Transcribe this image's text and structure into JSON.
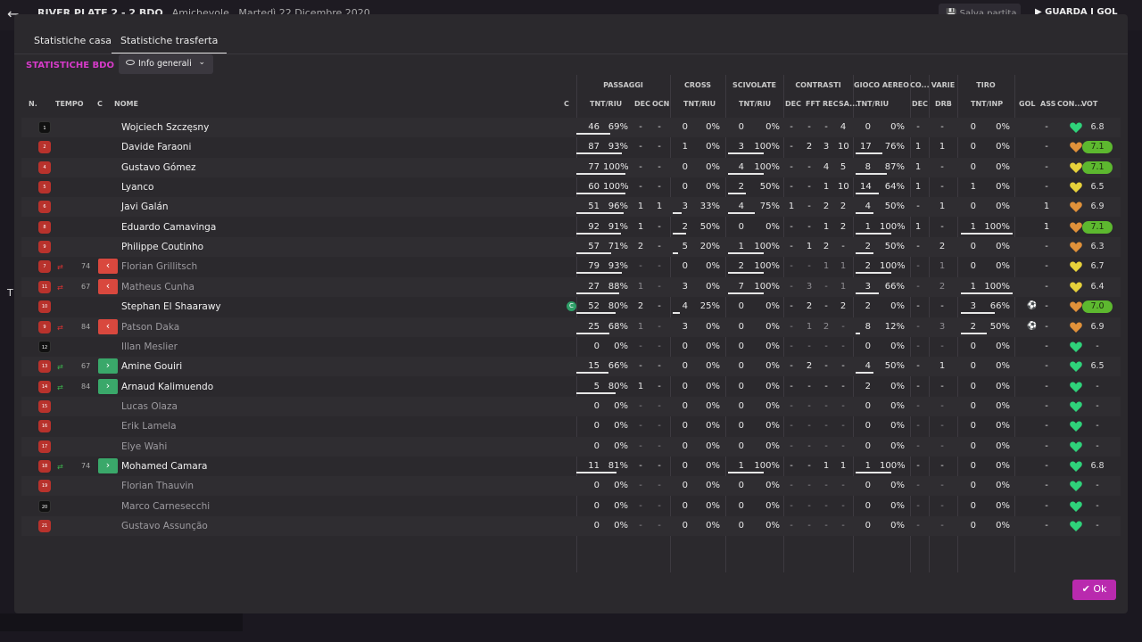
{
  "background": {
    "match_title": "RIVER PLATE 2 - 2 BDO",
    "match_type": "Amichevole",
    "match_date": "Martedì 22 Dicembre 2020",
    "save_label": "Salva partita",
    "watch_label": "GUARDA I GOL"
  },
  "tabs": [
    "Statistiche casa",
    "Statistiche trasferta"
  ],
  "active_tab": 1,
  "stats_label": "STATISTICHE BDO",
  "view_select": "Info generali",
  "groups": {
    "passaggi": "PASSAGGI",
    "cross": "CROSS",
    "scivolate": "SCIVOLATE",
    "contrasti": "CONTRASTI",
    "gioco_aereo": "GIOCO AEREO",
    "co": "CO...",
    "varie": "VARIE",
    "tiro": "TIRO"
  },
  "headers": {
    "n": "N.",
    "tempo": "TEMPO",
    "c": "C",
    "nome": "NOME",
    "cap": "C",
    "pass": "TNT/RIU",
    "dec": "DEC",
    "ocn": "OCN",
    "cross": "TNT/RIU",
    "sciv": "TNT/RIU",
    "ct_dec": "DEC",
    "ct_fft": "FFT",
    "ct_rec": "REC",
    "ct_sa": "SA...",
    "aereo": "TNT/RIU",
    "co_dec": "DEC",
    "drb": "DRB",
    "tiro": "TNT/INP",
    "gol": "GOL",
    "ass": "ASS",
    "con": "CON...",
    "vot": "VOT"
  },
  "colors": {
    "accent": "#d63bc9",
    "sub_out": "#d9483e",
    "sub_in": "#3aa86a",
    "heart_green": "#2fd27a",
    "heart_orange": "#e0913a",
    "heart_yellow": "#e6d13b",
    "rating_high": "#5db82f"
  },
  "players": [
    {
      "num": "1",
      "gk": true,
      "name": "Wojciech Szczęsny",
      "p": "46",
      "pp": "69%",
      "pd": "-",
      "po": "-",
      "cr": "0",
      "crp": "0%",
      "sc": "0",
      "scp": "0%",
      "cd": "-",
      "cf": "-",
      "cre": "-",
      "cs": "4",
      "ae": "0",
      "aep": "0%",
      "cod": "-",
      "drb": "-",
      "ti": "0",
      "tip": "0%",
      "gol": "",
      "ass": "-",
      "con": "green",
      "vot": "6.8",
      "hi": false,
      "bars": {
        "p": 0.69
      }
    },
    {
      "num": "2",
      "name": "Davide Faraoni",
      "p": "87",
      "pp": "93%",
      "pd": "-",
      "po": "-",
      "cr": "1",
      "crp": "0%",
      "sc": "3",
      "scp": "100%",
      "cd": "-",
      "cf": "2",
      "cre": "3",
      "cs": "10",
      "ae": "17",
      "aep": "76%",
      "cod": "1",
      "drb": "1",
      "ti": "0",
      "tip": "0%",
      "gol": "",
      "ass": "-",
      "con": "orange",
      "vot": "7.1",
      "hi": true,
      "bars": {
        "p": 0.93,
        "sc": 1.0,
        "ae": 0.76
      }
    },
    {
      "num": "4",
      "name": "Gustavo Gómez",
      "p": "77",
      "pp": "100%",
      "pd": "-",
      "po": "-",
      "cr": "0",
      "crp": "0%",
      "sc": "4",
      "scp": "100%",
      "cd": "-",
      "cf": "-",
      "cre": "4",
      "cs": "5",
      "ae": "8",
      "aep": "87%",
      "cod": "1",
      "drb": "-",
      "ti": "0",
      "tip": "0%",
      "gol": "",
      "ass": "-",
      "con": "yellow",
      "vot": "7.1",
      "hi": true,
      "bars": {
        "p": 1.0,
        "sc": 1.0,
        "ae": 0.87
      }
    },
    {
      "num": "5",
      "name": "Lyanco",
      "p": "60",
      "pp": "100%",
      "pd": "-",
      "po": "-",
      "cr": "0",
      "crp": "0%",
      "sc": "2",
      "scp": "50%",
      "cd": "-",
      "cf": "-",
      "cre": "1",
      "cs": "10",
      "ae": "14",
      "aep": "64%",
      "cod": "1",
      "drb": "-",
      "ti": "1",
      "tip": "0%",
      "gol": "",
      "ass": "-",
      "con": "yellow",
      "vot": "6.5",
      "hi": false,
      "bars": {
        "p": 1.0,
        "sc": 0.5,
        "ae": 0.64
      }
    },
    {
      "num": "6",
      "name": "Javi Galán",
      "p": "51",
      "pp": "96%",
      "pd": "1",
      "po": "1",
      "cr": "3",
      "crp": "33%",
      "sc": "4",
      "scp": "75%",
      "cd": "1",
      "cf": "-",
      "cre": "2",
      "cs": "2",
      "ae": "4",
      "aep": "50%",
      "cod": "-",
      "drb": "1",
      "ti": "0",
      "tip": "0%",
      "gol": "",
      "ass": "1",
      "con": "orange",
      "vot": "6.9",
      "hi": false,
      "bars": {
        "p": 0.96,
        "cr": 0.33,
        "sc": 0.75,
        "ae": 0.5
      }
    },
    {
      "num": "8",
      "name": "Eduardo Camavinga",
      "p": "92",
      "pp": "91%",
      "pd": "1",
      "po": "-",
      "cr": "2",
      "crp": "50%",
      "sc": "0",
      "scp": "0%",
      "cd": "-",
      "cf": "-",
      "cre": "1",
      "cs": "2",
      "ae": "1",
      "aep": "100%",
      "cod": "1",
      "drb": "-",
      "ti": "1",
      "tip": "100%",
      "gol": "",
      "ass": "1",
      "con": "orange",
      "vot": "7.1",
      "hi": true,
      "bars": {
        "p": 0.91,
        "cr": 0.5,
        "ae": 1.0,
        "ti": 1.0
      }
    },
    {
      "num": "9",
      "name": "Philippe Coutinho",
      "p": "57",
      "pp": "71%",
      "pd": "2",
      "po": "-",
      "cr": "5",
      "crp": "20%",
      "sc": "1",
      "scp": "100%",
      "cd": "-",
      "cf": "1",
      "cre": "2",
      "cs": "-",
      "ae": "2",
      "aep": "50%",
      "cod": "-",
      "drb": "2",
      "ti": "0",
      "tip": "0%",
      "gol": "",
      "ass": "-",
      "con": "orange",
      "vot": "6.3",
      "hi": false,
      "bars": {
        "p": 0.71,
        "cr": 0.2,
        "sc": 1.0,
        "ae": 0.5
      }
    },
    {
      "num": "7",
      "sub": "out",
      "min": "74",
      "dim": true,
      "name": "Florian Grillitsch",
      "p": "79",
      "pp": "93%",
      "pd": "-",
      "po": "-",
      "cr": "0",
      "crp": "0%",
      "sc": "2",
      "scp": "100%",
      "cd": "-",
      "cf": "-",
      "cre": "1",
      "cs": "1",
      "ae": "2",
      "aep": "100%",
      "cod": "-",
      "drb": "1",
      "ti": "0",
      "tip": "0%",
      "gol": "",
      "ass": "-",
      "con": "yellow",
      "vot": "6.7",
      "hi": false,
      "bars": {
        "p": 0.93,
        "sc": 1.0,
        "ae": 1.0
      }
    },
    {
      "num": "11",
      "sub": "out",
      "min": "67",
      "dim": true,
      "name": "Matheus Cunha",
      "p": "27",
      "pp": "88%",
      "pd": "1",
      "po": "-",
      "cr": "3",
      "crp": "0%",
      "sc": "7",
      "scp": "100%",
      "cd": "-",
      "cf": "3",
      "cre": "-",
      "cs": "1",
      "ae": "3",
      "aep": "66%",
      "cod": "-",
      "drb": "2",
      "ti": "1",
      "tip": "100%",
      "gol": "",
      "ass": "-",
      "con": "yellow",
      "vot": "6.4",
      "hi": false,
      "bars": {
        "p": 0.88,
        "sc": 1.0,
        "ae": 0.66,
        "ti": 1.0
      }
    },
    {
      "num": "10",
      "cap": true,
      "name": "Stephan El Shaarawy",
      "p": "52",
      "pp": "80%",
      "pd": "2",
      "po": "-",
      "cr": "4",
      "crp": "25%",
      "sc": "0",
      "scp": "0%",
      "cd": "-",
      "cf": "2",
      "cre": "-",
      "cs": "2",
      "ae": "2",
      "aep": "0%",
      "cod": "-",
      "drb": "-",
      "ti": "3",
      "tip": "66%",
      "gol": "⚽",
      "ass": "-",
      "con": "orange",
      "vot": "7.0",
      "hi": true,
      "bars": {
        "p": 0.8,
        "cr": 0.25,
        "ti": 0.66
      }
    },
    {
      "num": "9",
      "sub": "out",
      "min": "84",
      "dim": true,
      "name": "Patson Daka",
      "p": "25",
      "pp": "68%",
      "pd": "1",
      "po": "-",
      "cr": "3",
      "crp": "0%",
      "sc": "0",
      "scp": "0%",
      "cd": "-",
      "cf": "1",
      "cre": "2",
      "cs": "-",
      "ae": "8",
      "aep": "12%",
      "cod": "-",
      "drb": "3",
      "ti": "2",
      "tip": "50%",
      "gol": "⚽",
      "ass": "-",
      "con": "orange",
      "vot": "6.9",
      "hi": false,
      "bars": {
        "p": 0.68,
        "ae": 0.12,
        "ti": 0.5
      }
    },
    {
      "num": "12",
      "gk": true,
      "dim": true,
      "name": "Illan Meslier",
      "p": "0",
      "pp": "0%",
      "pd": "-",
      "po": "-",
      "cr": "0",
      "crp": "0%",
      "sc": "0",
      "scp": "0%",
      "cd": "-",
      "cf": "-",
      "cre": "-",
      "cs": "-",
      "ae": "0",
      "aep": "0%",
      "cod": "-",
      "drb": "-",
      "ti": "0",
      "tip": "0%",
      "gol": "",
      "ass": "-",
      "con": "green",
      "vot": "-",
      "hi": false,
      "bars": {}
    },
    {
      "num": "13",
      "sub": "in",
      "min": "67",
      "name": "Amine Gouiri",
      "p": "15",
      "pp": "66%",
      "pd": "-",
      "po": "-",
      "cr": "0",
      "crp": "0%",
      "sc": "0",
      "scp": "0%",
      "cd": "-",
      "cf": "2",
      "cre": "-",
      "cs": "-",
      "ae": "4",
      "aep": "50%",
      "cod": "-",
      "drb": "1",
      "ti": "0",
      "tip": "0%",
      "gol": "",
      "ass": "-",
      "con": "green",
      "vot": "6.5",
      "hi": false,
      "bars": {
        "p": 0.66,
        "ae": 0.5
      }
    },
    {
      "num": "14",
      "sub": "in",
      "min": "84",
      "name": "Arnaud Kalimuendo",
      "p": "5",
      "pp": "80%",
      "pd": "1",
      "po": "-",
      "cr": "0",
      "crp": "0%",
      "sc": "0",
      "scp": "0%",
      "cd": "-",
      "cf": "-",
      "cre": "-",
      "cs": "-",
      "ae": "2",
      "aep": "0%",
      "cod": "-",
      "drb": "-",
      "ti": "0",
      "tip": "0%",
      "gol": "",
      "ass": "-",
      "con": "green",
      "vot": "-",
      "hi": false,
      "bars": {
        "p": 0.8
      }
    },
    {
      "num": "15",
      "dim": true,
      "name": "Lucas Olaza",
      "p": "0",
      "pp": "0%",
      "pd": "-",
      "po": "-",
      "cr": "0",
      "crp": "0%",
      "sc": "0",
      "scp": "0%",
      "cd": "-",
      "cf": "-",
      "cre": "-",
      "cs": "-",
      "ae": "0",
      "aep": "0%",
      "cod": "-",
      "drb": "-",
      "ti": "0",
      "tip": "0%",
      "gol": "",
      "ass": "-",
      "con": "green",
      "vot": "-",
      "hi": false,
      "bars": {}
    },
    {
      "num": "16",
      "dim": true,
      "name": "Erik Lamela",
      "p": "0",
      "pp": "0%",
      "pd": "-",
      "po": "-",
      "cr": "0",
      "crp": "0%",
      "sc": "0",
      "scp": "0%",
      "cd": "-",
      "cf": "-",
      "cre": "-",
      "cs": "-",
      "ae": "0",
      "aep": "0%",
      "cod": "-",
      "drb": "-",
      "ti": "0",
      "tip": "0%",
      "gol": "",
      "ass": "-",
      "con": "green",
      "vot": "-",
      "hi": false,
      "bars": {}
    },
    {
      "num": "17",
      "dim": true,
      "name": "Elye Wahi",
      "p": "0",
      "pp": "0%",
      "pd": "-",
      "po": "-",
      "cr": "0",
      "crp": "0%",
      "sc": "0",
      "scp": "0%",
      "cd": "-",
      "cf": "-",
      "cre": "-",
      "cs": "-",
      "ae": "0",
      "aep": "0%",
      "cod": "-",
      "drb": "-",
      "ti": "0",
      "tip": "0%",
      "gol": "",
      "ass": "-",
      "con": "green",
      "vot": "-",
      "hi": false,
      "bars": {}
    },
    {
      "num": "18",
      "sub": "in",
      "min": "74",
      "name": "Mohamed Camara",
      "p": "11",
      "pp": "81%",
      "pd": "-",
      "po": "-",
      "cr": "0",
      "crp": "0%",
      "sc": "1",
      "scp": "100%",
      "cd": "-",
      "cf": "-",
      "cre": "1",
      "cs": "1",
      "ae": "1",
      "aep": "100%",
      "cod": "-",
      "drb": "-",
      "ti": "0",
      "tip": "0%",
      "gol": "",
      "ass": "-",
      "con": "green",
      "vot": "6.8",
      "hi": false,
      "bars": {
        "p": 0.81,
        "sc": 1.0,
        "ae": 1.0
      }
    },
    {
      "num": "19",
      "dim": true,
      "name": "Florian Thauvin",
      "p": "0",
      "pp": "0%",
      "pd": "-",
      "po": "-",
      "cr": "0",
      "crp": "0%",
      "sc": "0",
      "scp": "0%",
      "cd": "-",
      "cf": "-",
      "cre": "-",
      "cs": "-",
      "ae": "0",
      "aep": "0%",
      "cod": "-",
      "drb": "-",
      "ti": "0",
      "tip": "0%",
      "gol": "",
      "ass": "-",
      "con": "green",
      "vot": "-",
      "hi": false,
      "bars": {}
    },
    {
      "num": "20",
      "gk": true,
      "dim": true,
      "name": "Marco Carnesecchi",
      "p": "0",
      "pp": "0%",
      "pd": "-",
      "po": "-",
      "cr": "0",
      "crp": "0%",
      "sc": "0",
      "scp": "0%",
      "cd": "-",
      "cf": "-",
      "cre": "-",
      "cs": "-",
      "ae": "0",
      "aep": "0%",
      "cod": "-",
      "drb": "-",
      "ti": "0",
      "tip": "0%",
      "gol": "",
      "ass": "-",
      "con": "green",
      "vot": "-",
      "hi": false,
      "bars": {}
    },
    {
      "num": "21",
      "dim": true,
      "name": "Gustavo Assunção",
      "p": "0",
      "pp": "0%",
      "pd": "-",
      "po": "-",
      "cr": "0",
      "crp": "0%",
      "sc": "0",
      "scp": "0%",
      "cd": "-",
      "cf": "-",
      "cre": "-",
      "cs": "-",
      "ae": "0",
      "aep": "0%",
      "cod": "-",
      "drb": "-",
      "ti": "0",
      "tip": "0%",
      "gol": "",
      "ass": "-",
      "con": "green",
      "vot": "-",
      "hi": false,
      "bars": {}
    }
  ],
  "ok_label": "Ok"
}
